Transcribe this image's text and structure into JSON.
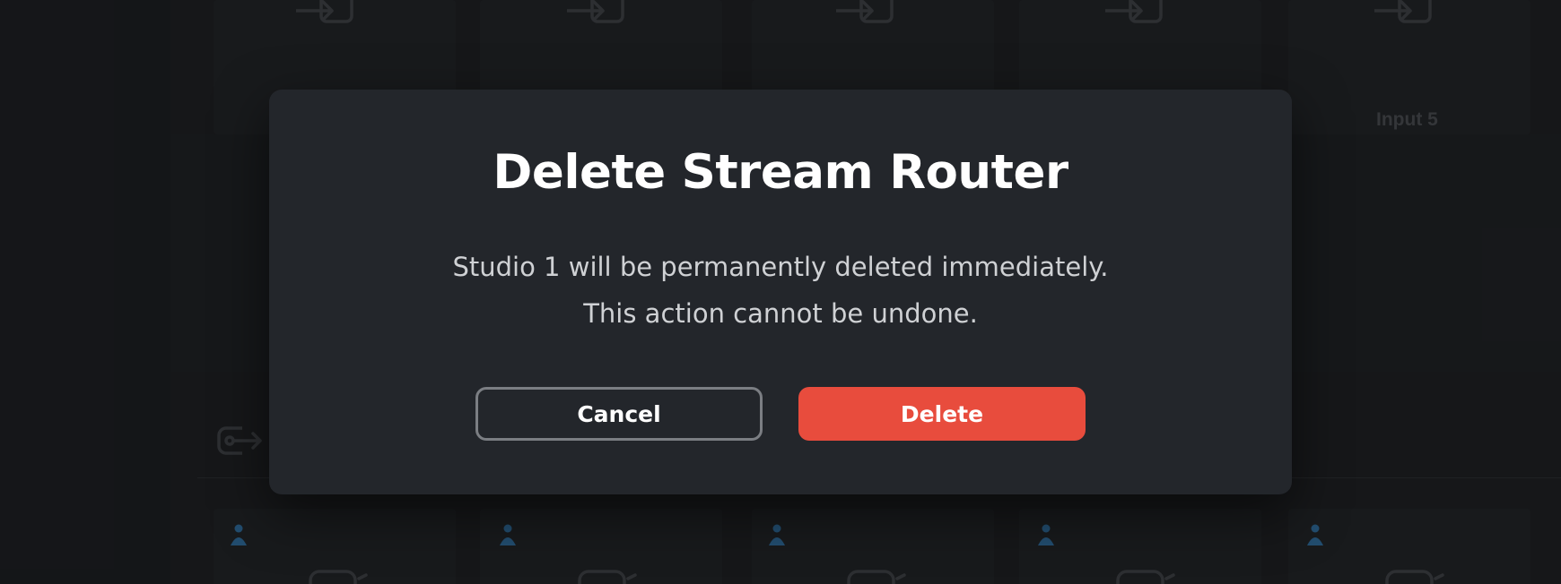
{
  "background": {
    "inputs": [
      "Input 5"
    ]
  },
  "dialog": {
    "title": "Delete Stream Router",
    "message_line1": "Studio 1 will be permanently deleted immediately.",
    "message_line2": "This action cannot be undone.",
    "cancel_label": "Cancel",
    "delete_label": "Delete"
  },
  "colors": {
    "dialog_bg": "#23262b",
    "danger": "#e84c3d",
    "cancel_border": "#7b7e83",
    "person_icon": "#2f6fa3"
  },
  "icons": {
    "input": "input-arrow-icon",
    "output": "output-arrow-icon",
    "person": "person-icon",
    "monitor": "monitor-icon"
  }
}
